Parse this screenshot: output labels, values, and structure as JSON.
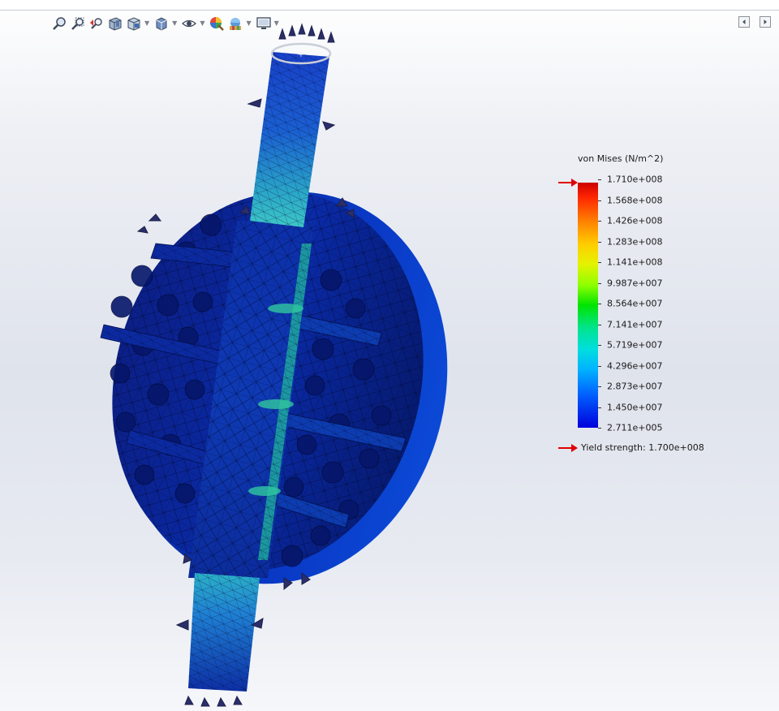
{
  "toolbar": {
    "icons": [
      "zoom-to-fit-icon",
      "zoom-to-area-icon",
      "previous-view-icon",
      "section-view-icon",
      "view-orientation-icon",
      "display-style-icon",
      "hide-show-items-icon",
      "edit-appearance-icon",
      "apply-scene-icon",
      "view-settings-icon"
    ]
  },
  "legend": {
    "title": "von Mises (N/m^2)",
    "ticks": [
      "1.710e+008",
      "1.568e+008",
      "1.426e+008",
      "1.283e+008",
      "1.141e+008",
      "9.987e+007",
      "8.564e+007",
      "7.141e+007",
      "5.719e+007",
      "4.296e+007",
      "2.873e+007",
      "1.450e+007",
      "2.711e+005"
    ],
    "yield_label": "Yield strength: 1.700e+008",
    "arrow_color": "#e00000"
  },
  "colors": {
    "accent_red": "#e00000",
    "mesh_blue": "#0a2a9a"
  }
}
